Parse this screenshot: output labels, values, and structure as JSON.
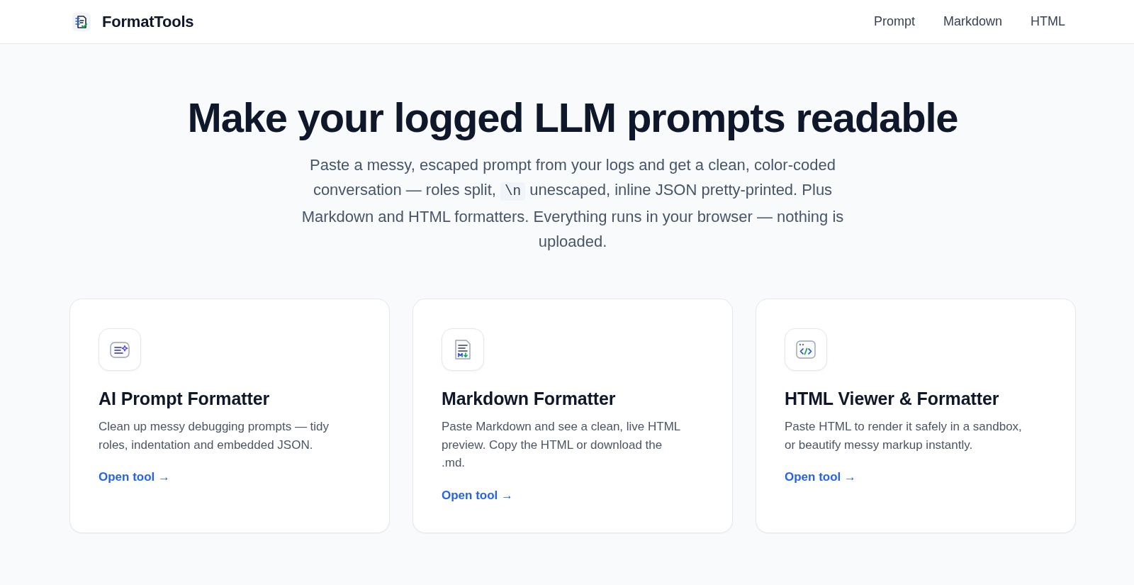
{
  "header": {
    "brand": "FormatTools",
    "nav": [
      {
        "label": "Prompt"
      },
      {
        "label": "Markdown"
      },
      {
        "label": "HTML"
      }
    ]
  },
  "hero": {
    "title": "Make your logged LLM prompts readable",
    "intro": [
      {
        "kind": "text",
        "text": "Paste a messy, escaped prompt from your logs and get a clean, color-coded conversation — roles split, "
      },
      {
        "kind": "code",
        "text": "\\n"
      },
      {
        "kind": "text",
        "text": " unescaped, inline JSON pretty-printed. Plus Markdown and HTML formatters. Everything runs in your browser — nothing is uploaded."
      }
    ]
  },
  "cards": [
    {
      "kind": "prompt",
      "title": "AI Prompt Formatter",
      "description": "Clean up messy debugging prompts — tidy roles, indentation and embedded JSON.",
      "link": "Open tool →"
    },
    {
      "kind": "markdown",
      "title": "Markdown Formatter",
      "description": "Paste Markdown and see a clean, live HTML preview. Copy the HTML or download the .md.",
      "link": "Open tool →"
    },
    {
      "kind": "html",
      "title": "HTML Viewer & Formatter",
      "description": "Paste HTML to render it safely in a sandbox, or beautify messy markup instantly.",
      "link": "Open tool →"
    }
  ]
}
